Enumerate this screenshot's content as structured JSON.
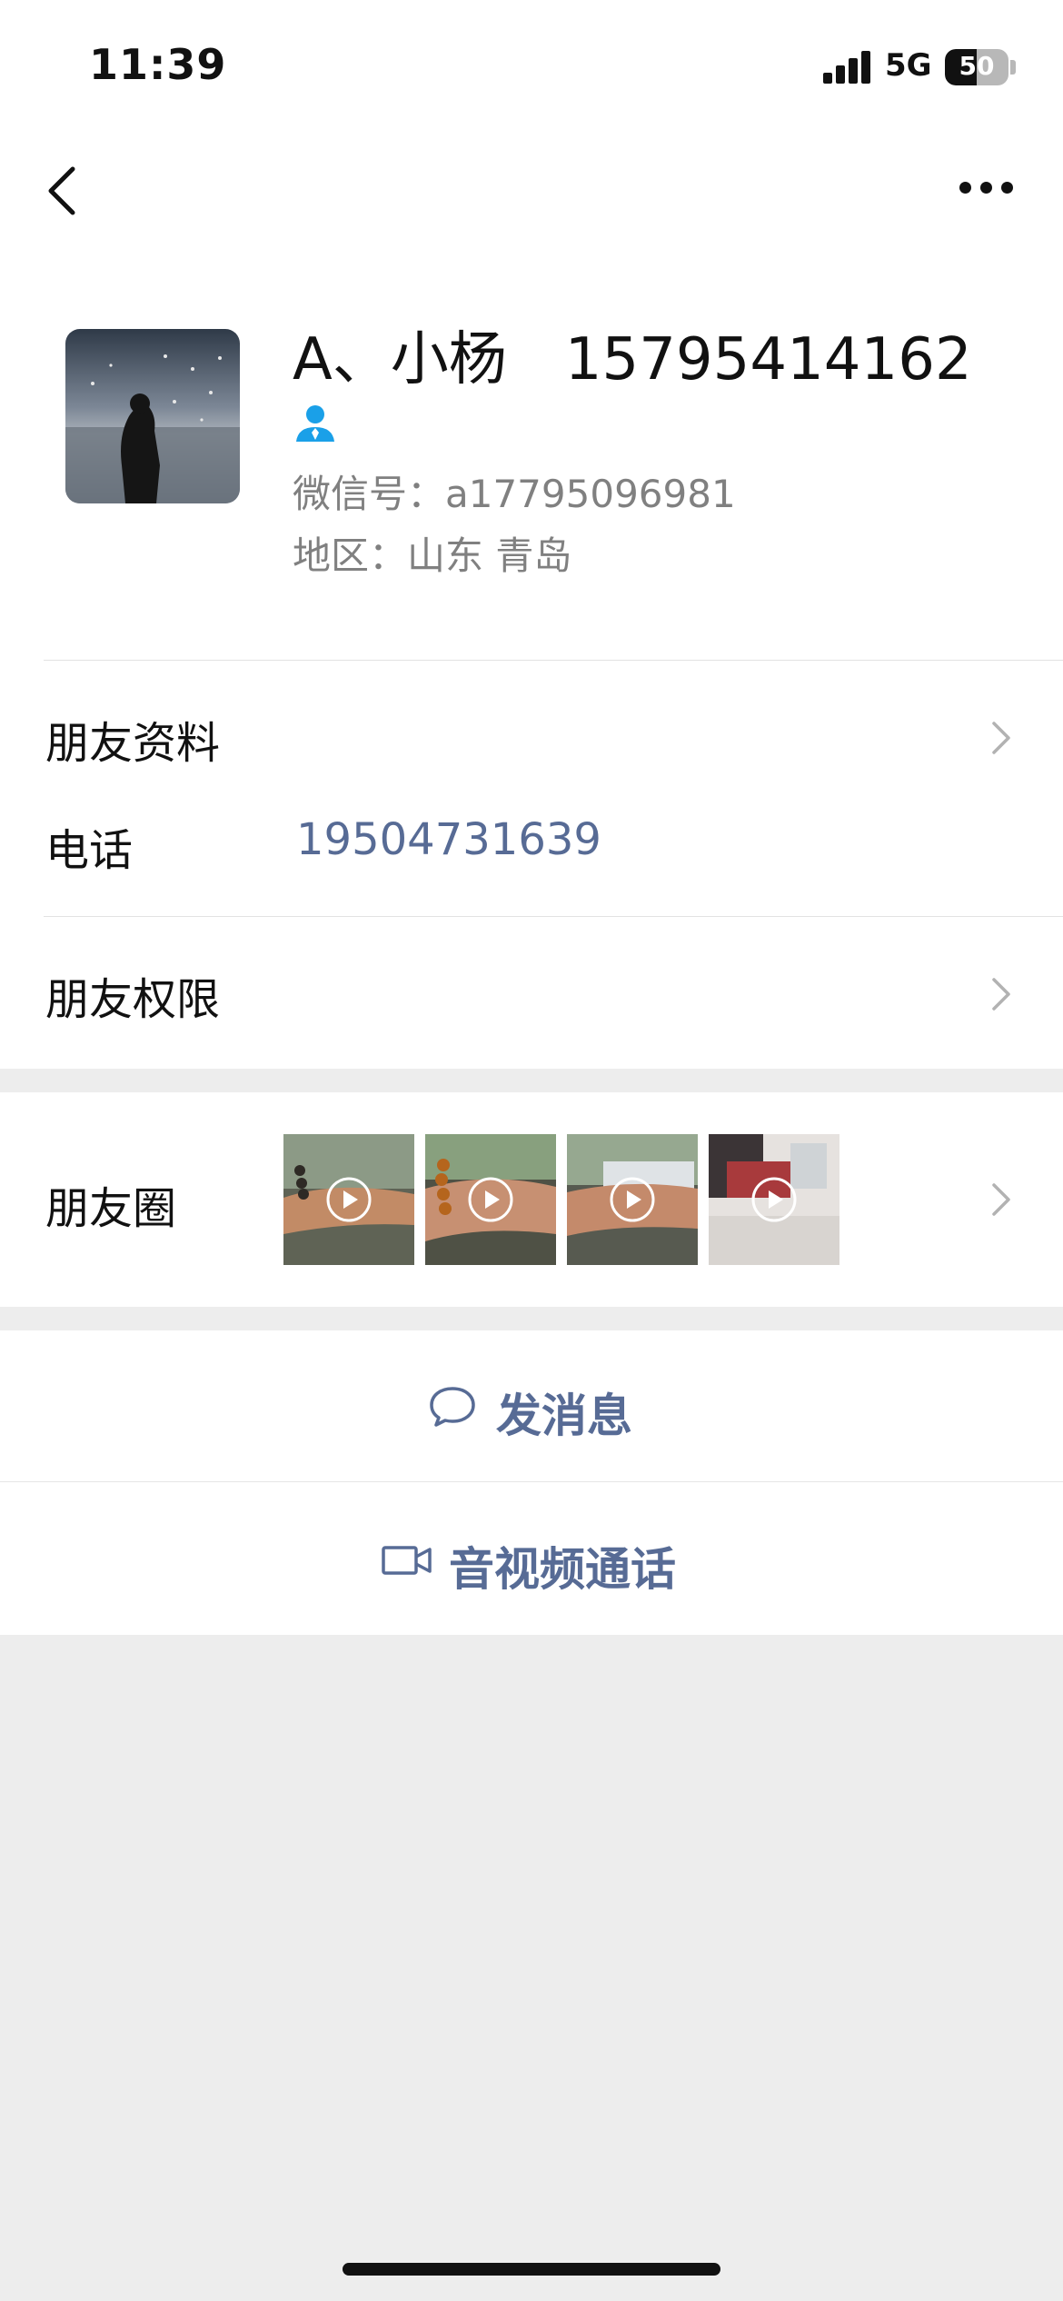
{
  "status_bar": {
    "time": "11:39",
    "network": "5G",
    "battery": "50",
    "battery_level": 0.5
  },
  "nav": {
    "back_icon": "chevron-left-icon",
    "more_icon": "more-horizontal-icon"
  },
  "profile": {
    "name": "A、小杨　15795414162",
    "wechat_id": "微信号：a17795096981",
    "region": "地区：山东 青岛",
    "contact_icon": "person-icon",
    "accent_color": "#1aa0e8"
  },
  "rows": {
    "friend_info_label": "朋友资料",
    "phone_label": "电话",
    "phone_value": "19504731639",
    "friend_permissions_label": "朋友权限",
    "moments_label": "朋友圈"
  },
  "actions": {
    "send_message_label": "发消息",
    "send_message_icon": "chat-bubble-icon",
    "call_label": "音视频通话",
    "call_icon": "video-camera-icon",
    "link_color": "#576b95"
  }
}
